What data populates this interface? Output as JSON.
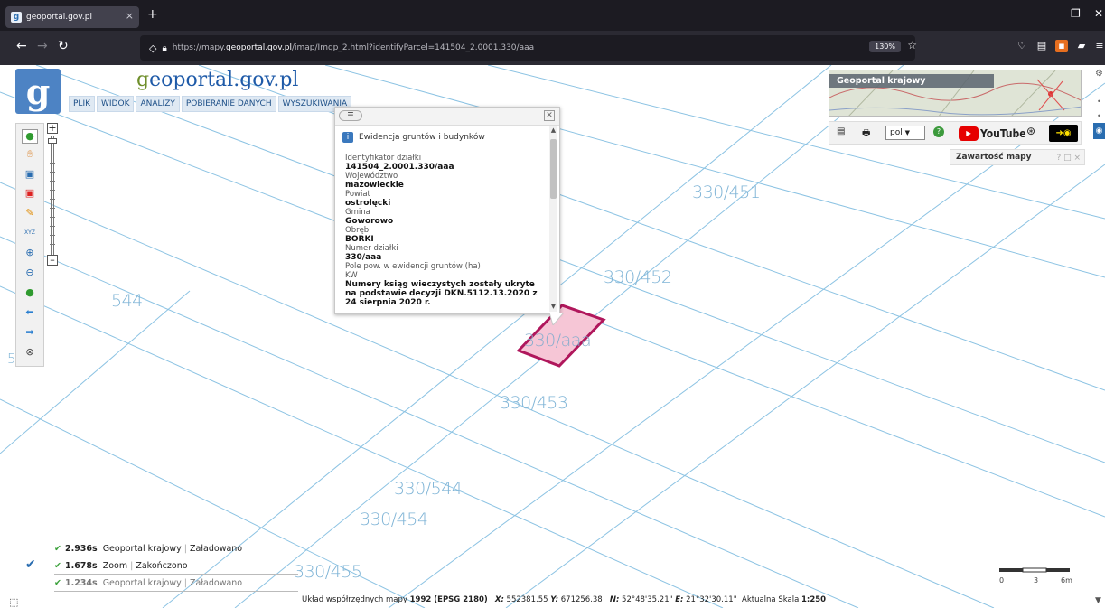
{
  "browser": {
    "tab_title": "geoportal.gov.pl",
    "tab_close": "×",
    "new_tab": "+",
    "url_prefix": "https://mapy.",
    "url_domain": "geoportal.gov.pl",
    "url_rest": "/imap/Imgp_2.html?identifyParcel=141504_2.0001.330/aaa",
    "zoom": "130%"
  },
  "header": {
    "logo_letter": "g",
    "brand_g": "g",
    "brand_rest": "eoportal.gov.pl",
    "menu": [
      "PLIK",
      "WIDOK",
      "ANALIZY",
      "POBIERANIE DANYCH",
      "WYSZUKIWANIA"
    ]
  },
  "popup": {
    "title": "Ewidencja gruntów i budynków",
    "info_icon": "i",
    "fields": [
      {
        "label": "Identyfikator działki",
        "value": "141504_2.0001.330/aaa"
      },
      {
        "label": "Województwo",
        "value": "mazowieckie"
      },
      {
        "label": "Powiat",
        "value": "ostrołęcki"
      },
      {
        "label": "Gmina",
        "value": "Goworowo"
      },
      {
        "label": "Obręb",
        "value": "BORKI"
      },
      {
        "label": "Numer działki",
        "value": "330/aaa"
      },
      {
        "label": "Pole pow. w ewidencji gruntów (ha)",
        "value": ""
      },
      {
        "label": "KW",
        "value": "Numery ksiąg wieczystych zostały ukryte na podstawie decyzji DKN.5112.13.2020 z 24 sierpnia 2020 r."
      }
    ]
  },
  "map": {
    "parcel_labels": [
      "330/451",
      "330/452",
      "544",
      "330/aaa",
      "330/453",
      "330/544",
      "330/454",
      "330/455",
      "5"
    ],
    "line_color": "#8cc3e3",
    "parcel_fill": "#f6c6d6",
    "parcel_stroke": "#b0175c"
  },
  "overview": {
    "title": "Geoportal krajowy"
  },
  "rtools": {
    "language": "pol",
    "youtube": "YouTube"
  },
  "contents_panel": {
    "title": "Zawartość mapy",
    "buttons": "? □ ×"
  },
  "log": [
    {
      "time": "2.936s",
      "source": "Geoportal krajowy",
      "status": "Załadowano"
    },
    {
      "time": "1.678s",
      "source": "Zoom",
      "status": "Zakończono"
    },
    {
      "time": "1.234s",
      "source": "Geoportal krajowy",
      "status": "Załadowano"
    }
  ],
  "statusbar": {
    "crs_label": "Układ współrzędnych mapy",
    "crs": "1992 (EPSG 2180)",
    "x_label": "X:",
    "x": "552381.55",
    "y_label": "Y:",
    "y": "671256.38",
    "n_label": "N:",
    "n": "52°48'35.21\"",
    "e_label": "E:",
    "e": "21°32'30.11\"",
    "scale_label": "Aktualna Skala",
    "scale": "1:250"
  },
  "scalebar": {
    "labels": [
      "0",
      "3",
      "6m"
    ]
  }
}
